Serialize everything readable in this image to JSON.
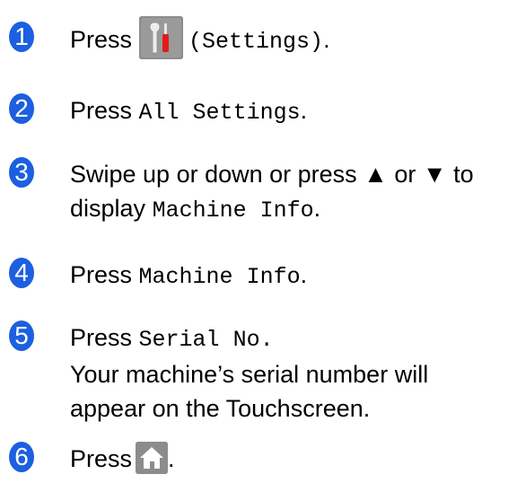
{
  "steps": [
    {
      "num": "1",
      "pre": "Press",
      "code": "(Settings)",
      "post": "."
    },
    {
      "num": "2",
      "pre": "Press",
      "code": "All Settings",
      "post": "."
    },
    {
      "num": "3",
      "line1": "Swipe up or down or press ▲ or ▼ to",
      "pre": "display",
      "code": "Machine Info",
      "post": "."
    },
    {
      "num": "4",
      "pre": "Press",
      "code": "Machine Info",
      "post": "."
    },
    {
      "num": "5",
      "pre": "Press",
      "code": "Serial No.",
      "line2": "Your machine’s serial number will",
      "line3": "appear on the Touchscreen."
    },
    {
      "num": "6",
      "pre": "Press",
      "post": "."
    }
  ],
  "icons": {
    "settings": "settings-tools-icon",
    "home": "home-icon"
  },
  "colors": {
    "step_badge": "#1c5fe0",
    "icon_button": "#8c8c8c"
  }
}
